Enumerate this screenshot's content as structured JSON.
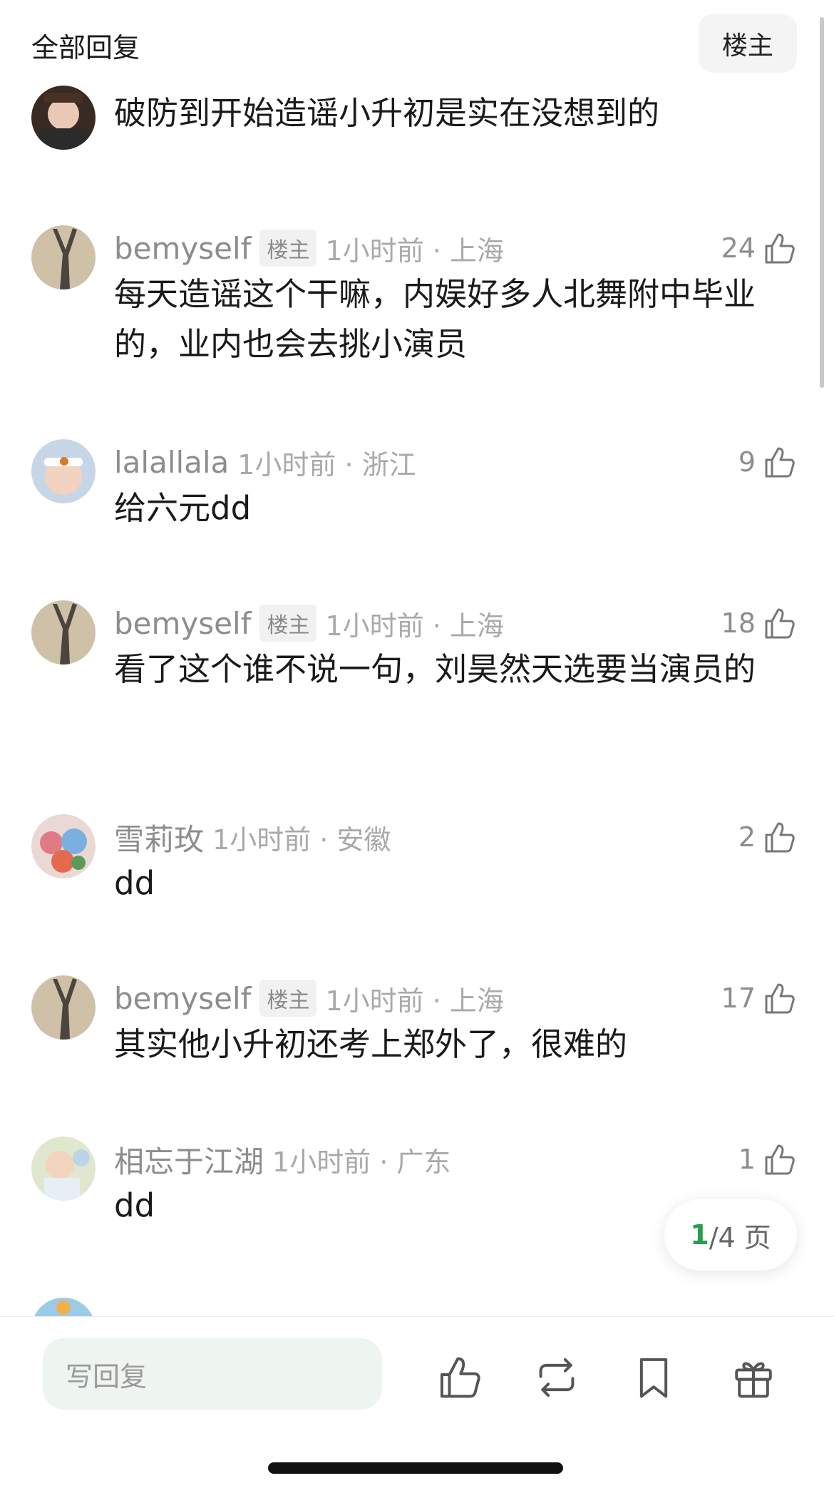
{
  "header": {
    "title": "全部回复",
    "op_filter_label": "楼主"
  },
  "comments": [
    {
      "username": "",
      "time": "",
      "likes": "",
      "text": "破防到开始造谣小升初是实在没想到的"
    },
    {
      "username": "bemyself",
      "badge": "楼主",
      "time": "1小时前 · 上海",
      "likes": "24",
      "text": "每天造谣这个干嘛，内娱好多人北舞附中毕业的，业内也会去挑小演员"
    },
    {
      "username": "lalallala",
      "time": "1小时前 · 浙江",
      "likes": "9",
      "text": "给六元dd"
    },
    {
      "username": "bemyself",
      "badge": "楼主",
      "time": "1小时前 · 上海",
      "likes": "18",
      "text": "看了这个谁不说一句，刘昊然天选要当演员的"
    },
    {
      "username": "雪莉玫",
      "time": "1小时前 · 安徽",
      "likes": "2",
      "text": "dd"
    },
    {
      "username": "bemyself",
      "badge": "楼主",
      "time": "1小时前 · 上海",
      "likes": "17",
      "text": "其实他小升初还考上郑外了，很难的"
    },
    {
      "username": "相忘于江湖",
      "time": "1小时前 · 广东",
      "likes": "1",
      "text": "dd"
    }
  ],
  "pager": {
    "current": "1",
    "rest": "/4 页"
  },
  "bottombar": {
    "reply_placeholder": "写回复",
    "icons": [
      "thumbs-up-icon",
      "repost-icon",
      "bookmark-icon",
      "gift-icon"
    ]
  },
  "colors": {
    "accent": "#25a04d",
    "input_bg": "#eef4ef",
    "muted": "#8d8d8d"
  }
}
